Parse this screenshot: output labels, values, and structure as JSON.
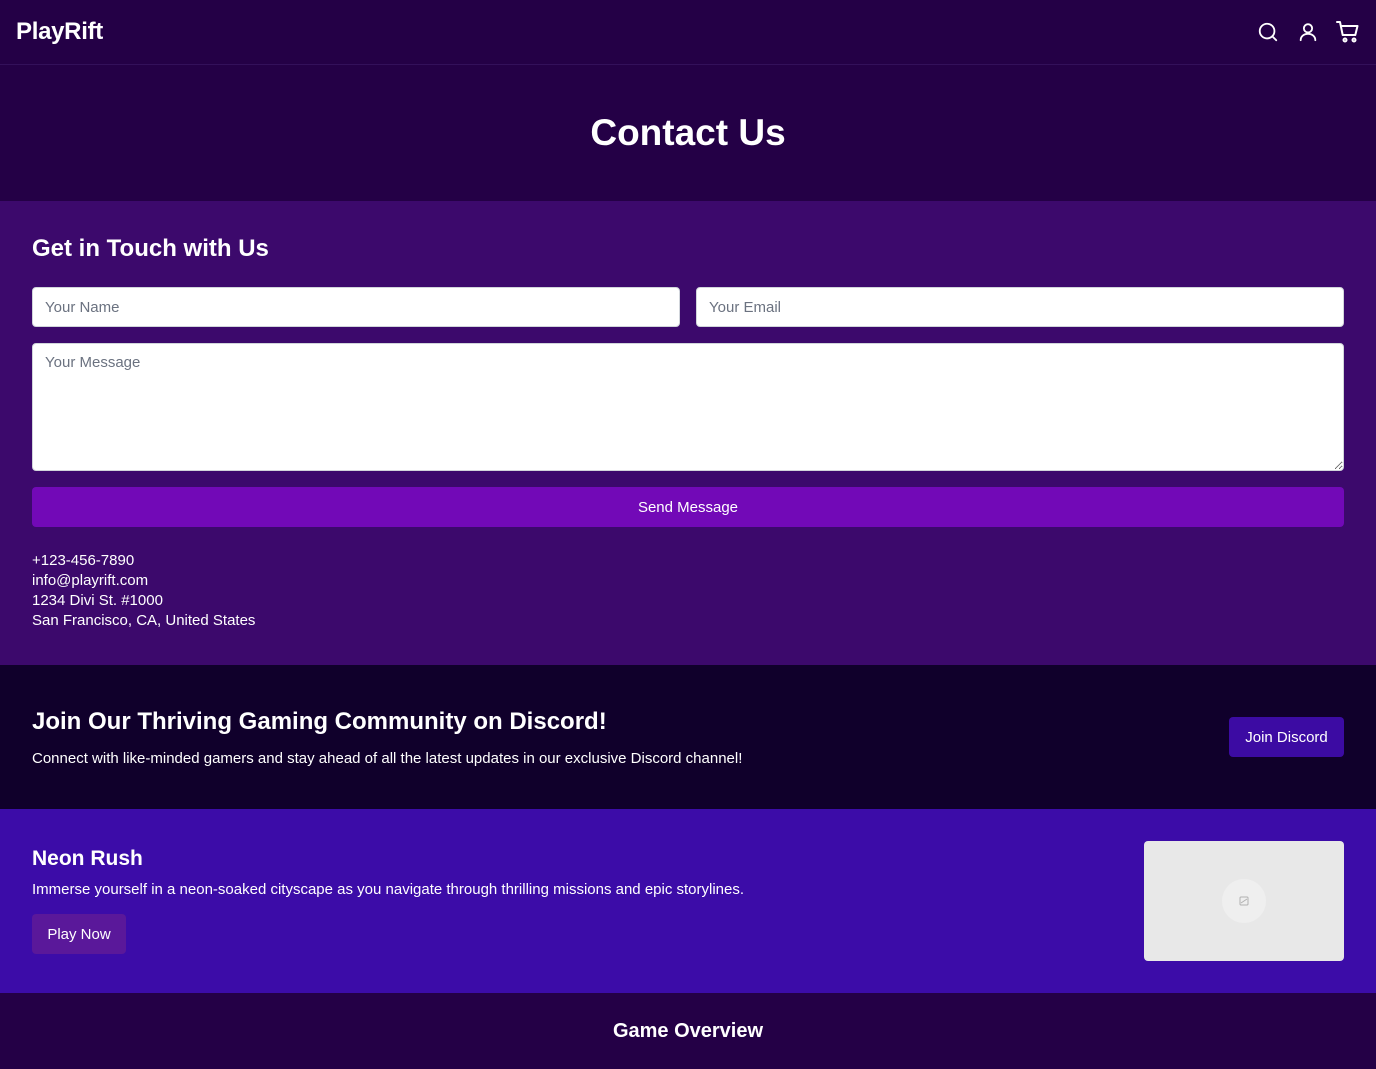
{
  "header": {
    "logo": "PlayRift",
    "icons": [
      "search-icon",
      "user-icon",
      "cart-icon"
    ]
  },
  "hero": {
    "title": "Contact Us"
  },
  "contact": {
    "heading": "Get in Touch with Us",
    "name_placeholder": "Your Name",
    "email_placeholder": "Your Email",
    "message_placeholder": "Your Message",
    "send_label": "Send Message",
    "phone": "+123-456-7890",
    "email": "info@playrift.com",
    "address_line1": "1234 Divi St. #1000",
    "address_line2": "San Francisco, CA, United States"
  },
  "discord": {
    "heading": "Join Our Thriving Gaming Community on Discord!",
    "text": "Connect with like-minded gamers and stay ahead of all the latest updates in our exclusive Discord channel!",
    "button_label": "Join Discord"
  },
  "featured_game": {
    "title": "Neon Rush",
    "description": "Immerse yourself in a neon-soaked cityscape as you navigate through thrilling missions and epic storylines.",
    "button_label": "Play Now"
  },
  "overview": {
    "heading": "Game Overview"
  },
  "colors": {
    "header_bg": "#240046",
    "contact_bg": "#3c096c",
    "send_button": "#7209b7",
    "discord_bg": "#10002b",
    "discord_button": "#3c0ba3",
    "game_bg": "#3c0ca8",
    "play_button": "#5a189a"
  }
}
